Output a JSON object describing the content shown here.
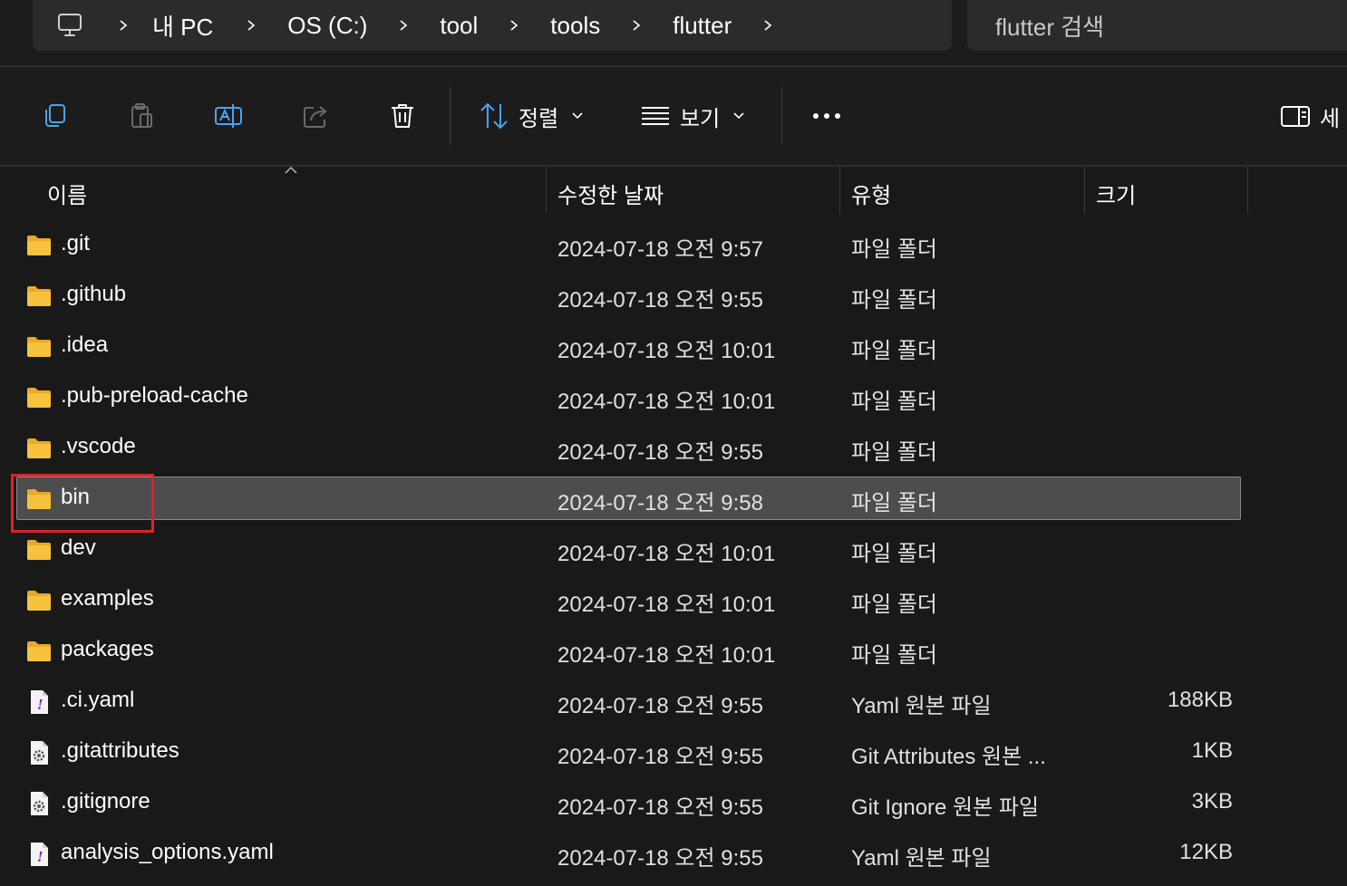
{
  "address_bar": {
    "crumbs": [
      "내 PC",
      "OS (C:)",
      "tool",
      "tools",
      "flutter"
    ]
  },
  "search": {
    "placeholder": "flutter 검색"
  },
  "command_bar": {
    "sort_label": "정렬",
    "view_label": "보기",
    "details_label": "세"
  },
  "columns": {
    "name": "이름",
    "date": "수정한 날짜",
    "type": "유형",
    "size": "크기"
  },
  "files": [
    {
      "name": ".git",
      "date": "2024-07-18 오전 9:57",
      "type": "파일 폴더",
      "size": "",
      "icon": "folder-icon"
    },
    {
      "name": ".github",
      "date": "2024-07-18 오전 9:55",
      "type": "파일 폴더",
      "size": "",
      "icon": "folder-icon"
    },
    {
      "name": ".idea",
      "date": "2024-07-18 오전 10:01",
      "type": "파일 폴더",
      "size": "",
      "icon": "folder-icon"
    },
    {
      "name": ".pub-preload-cache",
      "date": "2024-07-18 오전 10:01",
      "type": "파일 폴더",
      "size": "",
      "icon": "folder-icon"
    },
    {
      "name": ".vscode",
      "date": "2024-07-18 오전 9:55",
      "type": "파일 폴더",
      "size": "",
      "icon": "folder-icon"
    },
    {
      "name": "bin",
      "date": "2024-07-18 오전 9:58",
      "type": "파일 폴더",
      "size": "",
      "icon": "folder-icon",
      "selected": true
    },
    {
      "name": "dev",
      "date": "2024-07-18 오전 10:01",
      "type": "파일 폴더",
      "size": "",
      "icon": "folder-icon"
    },
    {
      "name": "examples",
      "date": "2024-07-18 오전 10:01",
      "type": "파일 폴더",
      "size": "",
      "icon": "folder-icon"
    },
    {
      "name": "packages",
      "date": "2024-07-18 오전 10:01",
      "type": "파일 폴더",
      "size": "",
      "icon": "folder-icon"
    },
    {
      "name": ".ci.yaml",
      "date": "2024-07-18 오전 9:55",
      "type": "Yaml 원본 파일",
      "size": "188KB",
      "icon": "yaml-file-icon"
    },
    {
      "name": ".gitattributes",
      "date": "2024-07-18 오전 9:55",
      "type": "Git Attributes 원본 ...",
      "size": "1KB",
      "icon": "settings-file-icon"
    },
    {
      "name": ".gitignore",
      "date": "2024-07-18 오전 9:55",
      "type": "Git Ignore 원본 파일",
      "size": "3KB",
      "icon": "settings-file-icon"
    },
    {
      "name": "analysis_options.yaml",
      "date": "2024-07-18 오전 9:55",
      "type": "Yaml 원본 파일",
      "size": "12KB",
      "icon": "yaml-file-icon"
    }
  ],
  "colors": {
    "background": "#191919",
    "selected_row": "#4d4d4d",
    "highlight_box": "#e0212b",
    "folder": "#f6c23c"
  }
}
